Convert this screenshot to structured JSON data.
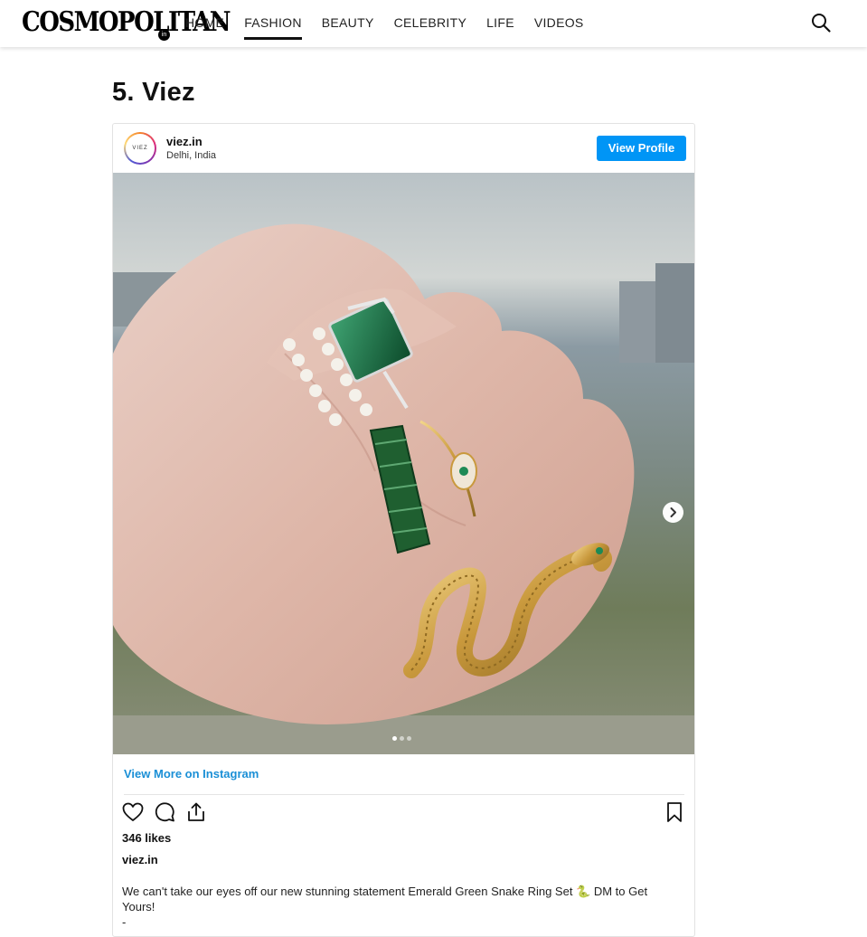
{
  "header": {
    "logo": "COSMOPOLITAN",
    "logo_sup": "in",
    "nav": [
      {
        "label": "HOME",
        "active": false
      },
      {
        "label": "FASHION",
        "active": true
      },
      {
        "label": "BEAUTY",
        "active": false
      },
      {
        "label": "CELEBRITY",
        "active": false
      },
      {
        "label": "LIFE",
        "active": false
      },
      {
        "label": "VIDEOS",
        "active": false
      }
    ],
    "search_icon": "search-icon"
  },
  "article": {
    "heading": "5. Viez"
  },
  "post": {
    "avatar_text": "VIEZ",
    "username": "viez.in",
    "location": "Delhi, India",
    "view_profile_label": "View Profile",
    "view_more_label": "View More on Instagram",
    "likes": "346 likes",
    "caption_user": "viez.in",
    "caption": "We can't take our eyes off our new stunning statement Emerald Green Snake Ring Set 🐍 DM to Get Yours!",
    "caption_dash": "-",
    "carousel_slide": 1,
    "carousel_total": 3,
    "accent_color": "#0095f6",
    "link_color": "#1a8fd6"
  }
}
